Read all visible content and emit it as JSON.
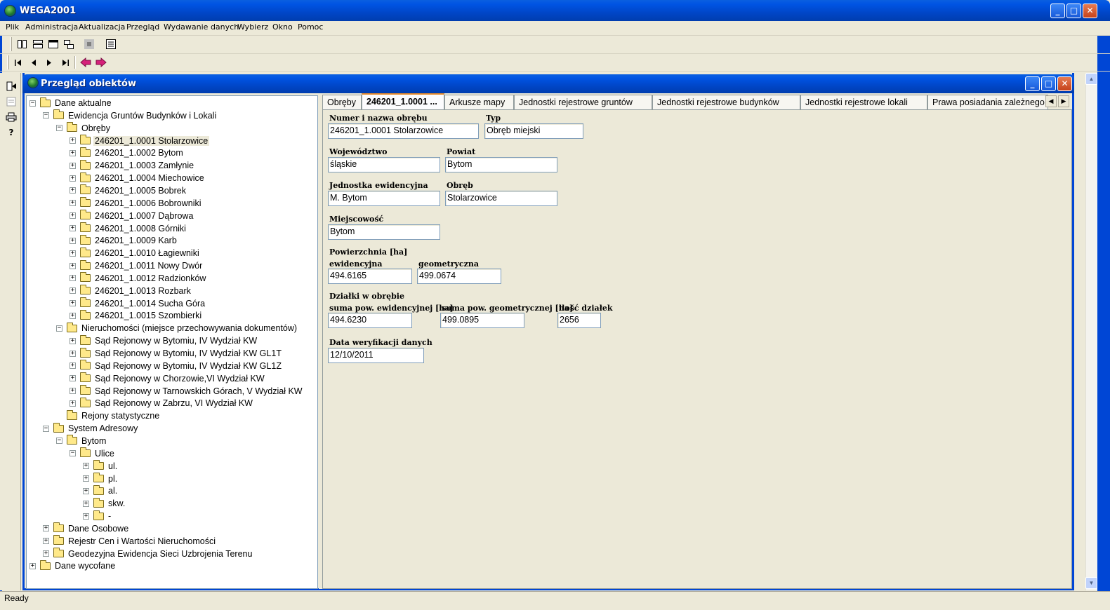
{
  "app": {
    "title": "WEGA2001"
  },
  "menu": [
    "Plik",
    "Administracja",
    "Aktualizacja",
    "Przegląd",
    "Wydawanie danych",
    "Wybierz",
    "Okno",
    "Pomoc"
  ],
  "child_window": {
    "title": "Przegląd obiektów"
  },
  "tree": [
    {
      "label": "Dane aktualne",
      "level": 0,
      "exp": "-"
    },
    {
      "label": "Ewidencja Gruntów Budynków i Lokali",
      "level": 1,
      "exp": "-"
    },
    {
      "label": "Obręby",
      "level": 2,
      "exp": "-"
    },
    {
      "label": "246201_1.0001 Stolarzowice",
      "level": 3,
      "exp": "+",
      "selected": true
    },
    {
      "label": "246201_1.0002 Bytom",
      "level": 3,
      "exp": "+"
    },
    {
      "label": "246201_1.0003 Zamłynie",
      "level": 3,
      "exp": "+"
    },
    {
      "label": "246201_1.0004 Miechowice",
      "level": 3,
      "exp": "+"
    },
    {
      "label": "246201_1.0005 Bobrek",
      "level": 3,
      "exp": "+"
    },
    {
      "label": "246201_1.0006 Bobrowniki",
      "level": 3,
      "exp": "+"
    },
    {
      "label": "246201_1.0007 Dąbrowa",
      "level": 3,
      "exp": "+"
    },
    {
      "label": "246201_1.0008 Górniki",
      "level": 3,
      "exp": "+"
    },
    {
      "label": "246201_1.0009 Karb",
      "level": 3,
      "exp": "+"
    },
    {
      "label": "246201_1.0010 Łagiewniki",
      "level": 3,
      "exp": "+"
    },
    {
      "label": "246201_1.0011 Nowy Dwór",
      "level": 3,
      "exp": "+"
    },
    {
      "label": "246201_1.0012 Radzionków",
      "level": 3,
      "exp": "+"
    },
    {
      "label": "246201_1.0013 Rozbark",
      "level": 3,
      "exp": "+"
    },
    {
      "label": "246201_1.0014 Sucha Góra",
      "level": 3,
      "exp": "+"
    },
    {
      "label": "246201_1.0015 Szombierki",
      "level": 3,
      "exp": "+"
    },
    {
      "label": "Nieruchomości (miejsce przechowywania dokumentów)",
      "level": 2,
      "exp": "-"
    },
    {
      "label": "Sąd Rejonowy w Bytomiu, IV Wydział KW",
      "level": 3,
      "exp": "+"
    },
    {
      "label": "Sąd Rejonowy w Bytomiu, IV Wydział KW GL1T",
      "level": 3,
      "exp": "+"
    },
    {
      "label": "Sąd Rejonowy w Bytomiu, IV Wydział KW GL1Z",
      "level": 3,
      "exp": "+"
    },
    {
      "label": "Sąd Rejonowy w Chorzowie,VI Wydział KW",
      "level": 3,
      "exp": "+"
    },
    {
      "label": "Sąd Rejonowy w Tarnowskich Górach, V Wydział KW",
      "level": 3,
      "exp": "+"
    },
    {
      "label": "Sąd Rejonowy w Zabrzu, VI Wydział KW",
      "level": 3,
      "exp": "+"
    },
    {
      "label": "Rejony statystyczne",
      "level": 2,
      "exp": ""
    },
    {
      "label": "System Adresowy",
      "level": 1,
      "exp": "-"
    },
    {
      "label": "Bytom",
      "level": 2,
      "exp": "-"
    },
    {
      "label": "Ulice",
      "level": 3,
      "exp": "-"
    },
    {
      "label": "ul.",
      "level": 4,
      "exp": "+"
    },
    {
      "label": "pl.",
      "level": 4,
      "exp": "+"
    },
    {
      "label": "al.",
      "level": 4,
      "exp": "+"
    },
    {
      "label": "skw.",
      "level": 4,
      "exp": "+"
    },
    {
      "label": "-",
      "level": 4,
      "exp": "+"
    },
    {
      "label": "Dane Osobowe",
      "level": 1,
      "exp": "+"
    },
    {
      "label": "Rejestr Cen i Wartości Nieruchomości",
      "level": 1,
      "exp": "+"
    },
    {
      "label": "Geodezyjna Ewidencja Sieci Uzbrojenia Terenu",
      "level": 1,
      "exp": "+"
    },
    {
      "label": "Dane wycofane",
      "level": 0,
      "exp": "+"
    }
  ],
  "tabs": [
    "Obręby",
    "246201_1.0001 ...",
    "Arkusze mapy",
    "Jednostki rejestrowe gruntów",
    "Jednostki rejestrowe budynków",
    "Jednostki rejestrowe lokali",
    "Prawa posiadania zależnego"
  ],
  "form": {
    "numer_label": "Numer i nazwa obrębu",
    "numer_value": "246201_1.0001 Stolarzowice",
    "typ_label": "Typ",
    "typ_value": "Obręb miejski",
    "woj_label": "Województwo",
    "woj_value": "śląskie",
    "powiat_label": "Powiat",
    "powiat_value": "Bytom",
    "jedn_label": "Jednostka ewidencyjna",
    "jedn_value": "M. Bytom",
    "obreb_label": "Obręb",
    "obreb_value": "Stolarzowice",
    "miejsc_label": "Miejscowość",
    "miejsc_value": "Bytom",
    "pow_label": "Powierzchnia [ha]",
    "ewid_label": "ewidencyjna",
    "ewid_value": "494.6165",
    "geom_label": "geometryczna",
    "geom_value": "499.0674",
    "dzialki_label": "Działki w obrębie",
    "suma_ewid_label": "suma pow. ewidencyjnej [ha]",
    "suma_ewid_value": "494.6230",
    "suma_geom_label": "suma pow. geometrycznej [ha]",
    "suma_geom_value": "499.0895",
    "ilosc_label": "ilość działek",
    "ilosc_value": "2656",
    "data_label": "Data weryfikacji danych",
    "data_value": "12/10/2011"
  },
  "status": {
    "text": "Ready"
  }
}
